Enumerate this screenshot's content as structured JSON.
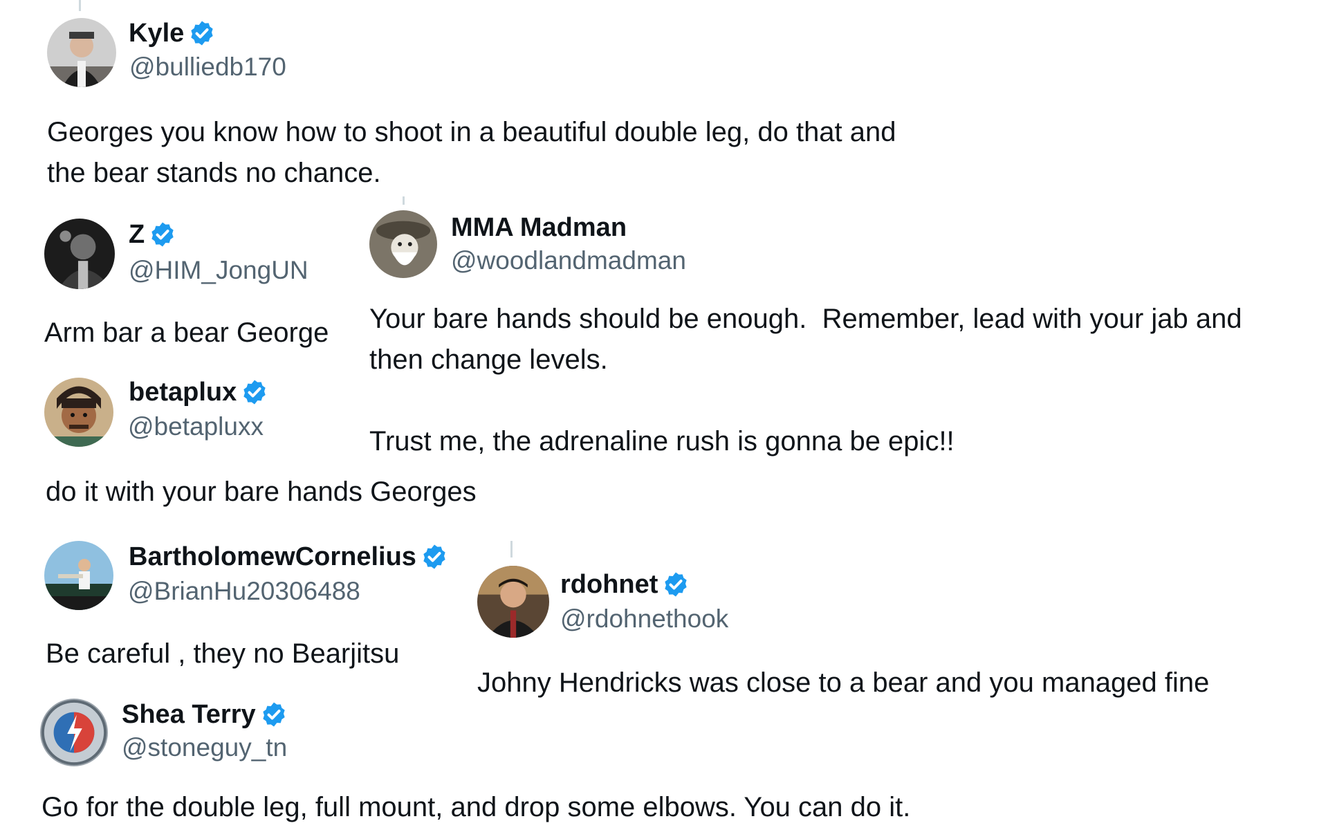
{
  "posts": [
    {
      "id": "kyle",
      "name": "Kyle",
      "verified": true,
      "handle": "@bulliedb170",
      "text": "Georges you know how to shoot in a beautiful double leg, do that and\nthe bear stands no chance."
    },
    {
      "id": "z",
      "name": "Z",
      "verified": true,
      "handle": "@HIM_JongUN",
      "text": "Arm bar a bear George"
    },
    {
      "id": "mma-madman",
      "name": "MMA Madman",
      "verified": false,
      "handle": "@woodlandmadman",
      "text": "Your bare hands should be enough.  Remember, lead with your jab and\nthen change levels.\n\nTrust me, the adrenaline rush is gonna be epic!!"
    },
    {
      "id": "betaplux",
      "name": "betaplux",
      "verified": true,
      "handle": "@betapluxx",
      "text": "do it with your bare hands Georges"
    },
    {
      "id": "bartholomew",
      "name": "BartholomewCornelius",
      "verified": true,
      "handle": "@BrianHu20306488",
      "text": "Be careful , they no Bearjitsu"
    },
    {
      "id": "rdohnet",
      "name": "rdohnet",
      "verified": true,
      "handle": "@rdohnethook",
      "text": "Johny Hendricks was close to a bear and you managed fine"
    },
    {
      "id": "shea-terry",
      "name": "Shea Terry",
      "verified": true,
      "handle": "@stoneguy_tn",
      "text": "Go for the double leg, full mount, and drop some elbows. You can do it."
    }
  ],
  "icons": {
    "verified": "verified-badge-icon",
    "verified_color": "#1d9bf0"
  }
}
